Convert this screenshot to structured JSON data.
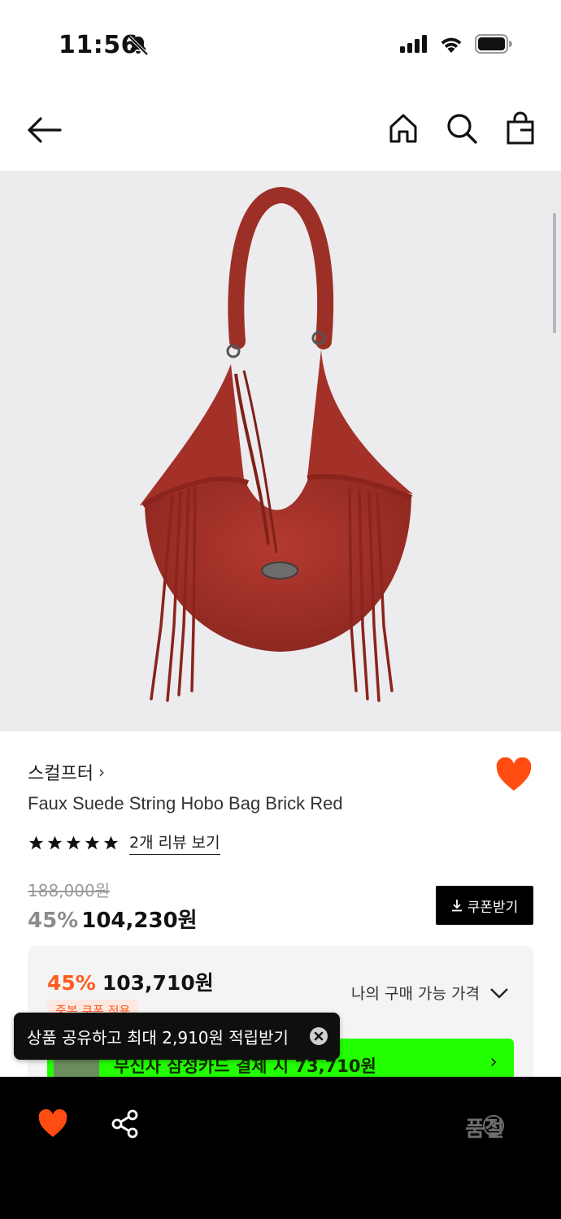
{
  "status_bar": {
    "time": "11:56"
  },
  "nav": {
    "back_icon": "arrow-left-icon",
    "home_icon": "home-icon",
    "search_icon": "search-icon",
    "cart_icon": "shopping-bag-icon"
  },
  "product": {
    "brand": "스컬프터",
    "brand_chevron": "›",
    "name": "Faux Suede String Hobo Bag Brick Red",
    "rating_stars": 5,
    "review_link": "2개 리뷰 보기",
    "original_price": "188,000원",
    "discount_rate": "45%",
    "price": "104,230원",
    "liked": true,
    "image_color": "#a8332a"
  },
  "coupon": {
    "label": "쿠폰받기",
    "icon": "download-icon"
  },
  "my_price": {
    "discount_rate": "45%",
    "price": "103,710원",
    "label": "나의 구매 가능 가격",
    "badge": "중복 쿠폰 적용",
    "card_banner_text": "무신사 삼성카드 결제 시 73,710원",
    "card_banner_color": "#22ff00",
    "accent_color": "#ff5a1f"
  },
  "toast": {
    "text": "상품 공유하고 최대 2,910원 적립받기"
  },
  "bottom_bar": {
    "status": "품절",
    "help": "?",
    "heart_color": "#ff4d12"
  }
}
